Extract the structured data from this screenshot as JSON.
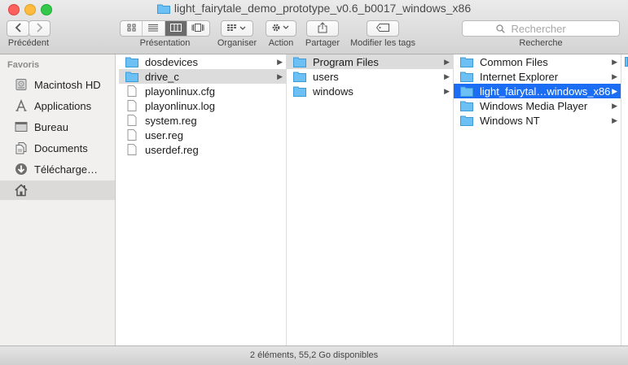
{
  "window": {
    "title": "light_fairytale_demo_prototype_v0.6_b0017_windows_x86"
  },
  "toolbar": {
    "back_label": "Précédent",
    "view_label": "Présentation",
    "organize_label": "Organiser",
    "action_label": "Action",
    "share_label": "Partager",
    "tags_label": "Modifier les tags",
    "search_label": "Recherche",
    "search_placeholder": "Rechercher",
    "active_view": "columns"
  },
  "sidebar": {
    "heading": "Favoris",
    "items": [
      {
        "label": "Macintosh HD",
        "icon": "hard-drive-icon"
      },
      {
        "label": "Applications",
        "icon": "applications-icon"
      },
      {
        "label": "Bureau",
        "icon": "desktop-icon"
      },
      {
        "label": "Documents",
        "icon": "documents-icon"
      },
      {
        "label": "Télécharge…",
        "icon": "downloads-icon"
      },
      {
        "label": "",
        "icon": "home-icon"
      }
    ]
  },
  "columns": [
    {
      "items": [
        {
          "name": "dosdevices",
          "type": "folder",
          "has_children": true
        },
        {
          "name": "drive_c",
          "type": "folder",
          "has_children": true,
          "selected": true
        },
        {
          "name": "playonlinux.cfg",
          "type": "file"
        },
        {
          "name": "playonlinux.log",
          "type": "file"
        },
        {
          "name": "system.reg",
          "type": "file"
        },
        {
          "name": "user.reg",
          "type": "file"
        },
        {
          "name": "userdef.reg",
          "type": "file"
        }
      ]
    },
    {
      "items": [
        {
          "name": "Program Files",
          "type": "folder",
          "has_children": true,
          "selected": true
        },
        {
          "name": "users",
          "type": "folder",
          "has_children": true
        },
        {
          "name": "windows",
          "type": "folder",
          "has_children": true
        }
      ]
    },
    {
      "items": [
        {
          "name": "Common Files",
          "type": "folder",
          "has_children": true
        },
        {
          "name": "Internet Explorer",
          "type": "folder",
          "has_children": true
        },
        {
          "name": "light_fairytal…windows_x86",
          "type": "folder",
          "has_children": true,
          "selected": true,
          "active": true
        },
        {
          "name": "Windows Media Player",
          "type": "folder",
          "has_children": true
        },
        {
          "name": "Windows NT",
          "type": "folder",
          "has_children": true
        }
      ]
    }
  ],
  "status": {
    "text": "2 éléments, 55,2 Go disponibles"
  },
  "colors": {
    "selection_active": "#1b6ef3",
    "selection_inactive": "#dcdcdc",
    "folder": "#5cb8f0"
  }
}
